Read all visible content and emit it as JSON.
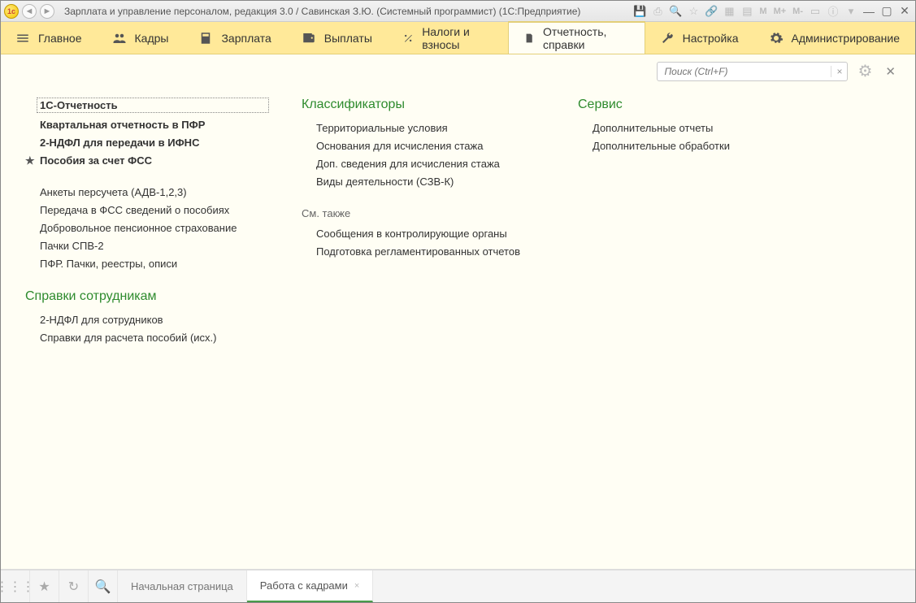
{
  "titlebar": {
    "app_title": "Зарплата и управление персоналом, редакция 3.0 / Савинская З.Ю. (Системный программист)  (1С:Предприятие)",
    "m_labels": [
      "M",
      "M+",
      "M-"
    ]
  },
  "toptabs": [
    {
      "id": "main",
      "label": "Главное"
    },
    {
      "id": "kadry",
      "label": "Кадры"
    },
    {
      "id": "zarplata",
      "label": "Зарплата"
    },
    {
      "id": "vyplaty",
      "label": "Выплаты"
    },
    {
      "id": "nalogi",
      "label": "Налоги и взносы"
    },
    {
      "id": "otchet",
      "label": "Отчетность, справки",
      "active": true
    },
    {
      "id": "nastroika",
      "label": "Настройка"
    },
    {
      "id": "admin",
      "label": "Администрирование"
    }
  ],
  "search": {
    "placeholder": "Поиск (Ctrl+F)"
  },
  "col1": {
    "group1": [
      {
        "label": "1С-Отчетность",
        "bold": true,
        "dashed": true
      },
      {
        "label": "Квартальная отчетность в ПФР",
        "bold": true
      },
      {
        "label": "2-НДФЛ для передачи в ИФНС",
        "bold": true
      },
      {
        "label": "Пособия за счет ФСС",
        "bold": true,
        "star": true
      }
    ],
    "group2": [
      {
        "label": "Анкеты персучета (АДВ-1,2,3)"
      },
      {
        "label": "Передача в ФСС сведений о пособиях"
      },
      {
        "label": "Добровольное пенсионное страхование"
      },
      {
        "label": "Пачки СПВ-2"
      },
      {
        "label": "ПФР. Пачки, реестры, описи"
      }
    ],
    "section2_title": "Справки сотрудникам",
    "group3": [
      {
        "label": "2-НДФЛ для сотрудников"
      },
      {
        "label": "Справки для расчета пособий (исх.)"
      }
    ]
  },
  "col2": {
    "section_title": "Классификаторы",
    "items": [
      {
        "label": "Территориальные условия"
      },
      {
        "label": "Основания для исчисления стажа"
      },
      {
        "label": "Доп. сведения для исчисления стажа"
      },
      {
        "label": "Виды деятельности (СЗВ-К)"
      }
    ],
    "seealso_title": "См. также",
    "seealso": [
      {
        "label": "Сообщения в контролирующие органы"
      },
      {
        "label": "Подготовка регламентированных отчетов"
      }
    ]
  },
  "col3": {
    "section_title": "Сервис",
    "items": [
      {
        "label": "Дополнительные отчеты"
      },
      {
        "label": "Дополнительные обработки"
      }
    ]
  },
  "bottombar": {
    "tabs": [
      {
        "label": "Начальная страница"
      },
      {
        "label": "Работа с кадрами",
        "active": true,
        "closable": true
      }
    ]
  }
}
